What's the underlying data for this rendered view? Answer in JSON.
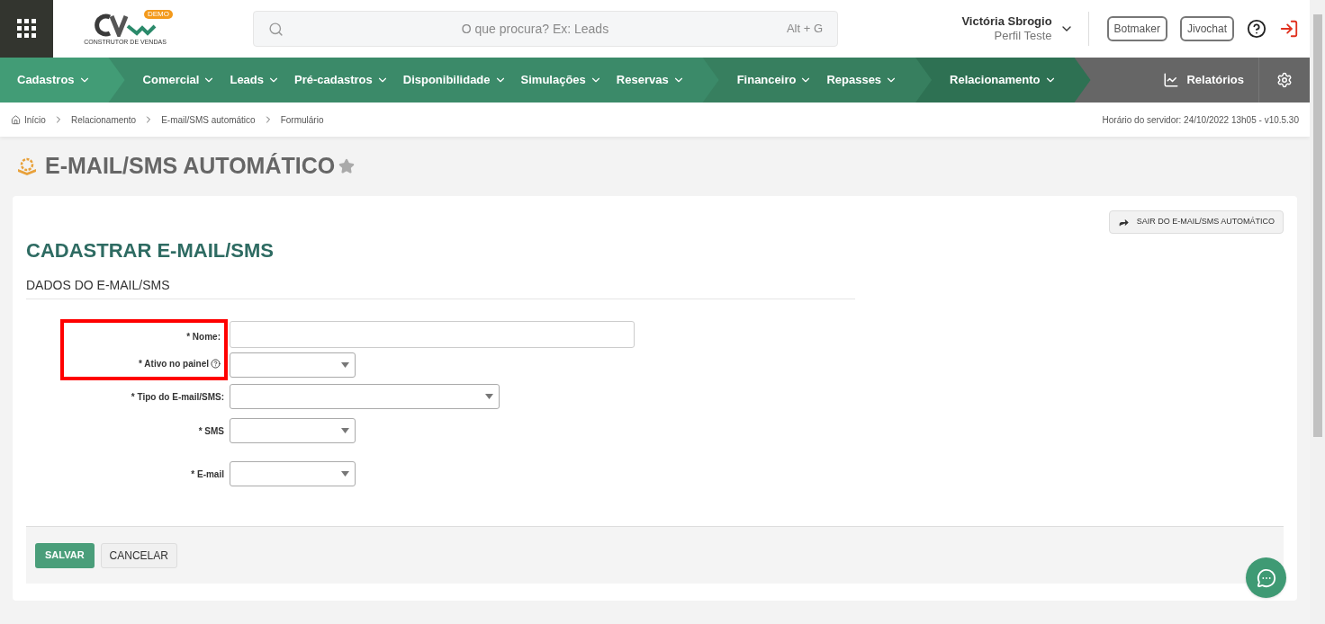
{
  "header": {
    "logo_badge": "DEMO",
    "logo_subtitle": "CONSTRUTOR DE VENDAS",
    "search": {
      "placeholder": "O que procura? Ex: Leads",
      "shortcut": "Alt + G"
    },
    "user": {
      "name": "Victória Sbrogio",
      "profile": "Perfil Teste"
    },
    "buttons": [
      "Botmaker",
      "Jivochat"
    ]
  },
  "nav": {
    "groups": [
      {
        "color": "#429c76",
        "items": [
          "Cadastros"
        ]
      },
      {
        "color": "#3b8a69",
        "items": [
          "Comercial",
          "Leads",
          "Pré-cadastros",
          "Disponibilidade",
          "Simulações",
          "Reservas"
        ]
      },
      {
        "color": "#377f5f",
        "items": [
          "Financeiro",
          "Repasses"
        ]
      },
      {
        "color": "#2e7153",
        "items": [
          "Relacionamento"
        ]
      }
    ],
    "reports": "Relatórios"
  },
  "breadcrumb": [
    "Início",
    "Relacionamento",
    "E-mail/SMS automático",
    "Formulário"
  ],
  "server_time": "Horário do servidor: 24/10/2022 13h05 - v10.5.30",
  "page_title": "E-MAIL/SMS AUTOMÁTICO",
  "exit_button": "SAIR DO E-MAIL/SMS AUTOMÁTICO",
  "form_title": "CADASTRAR E-MAIL/SMS",
  "section_title": "DADOS DO E-MAIL/SMS",
  "fields": [
    {
      "label": "* Nome:",
      "kind": "text",
      "help": false,
      "highlighted": true
    },
    {
      "label": "* Ativo no painel",
      "kind": "select",
      "help": true,
      "highlighted": true
    },
    {
      "label": "* Tipo do E-mail/SMS:",
      "kind": "select",
      "help": false,
      "highlighted": false
    },
    {
      "label": "* SMS",
      "kind": "select",
      "help": false,
      "highlighted": false
    },
    {
      "label": "* E-mail",
      "kind": "select",
      "help": false,
      "highlighted": false
    }
  ],
  "actions": [
    "SALVAR",
    "CANCELAR"
  ]
}
